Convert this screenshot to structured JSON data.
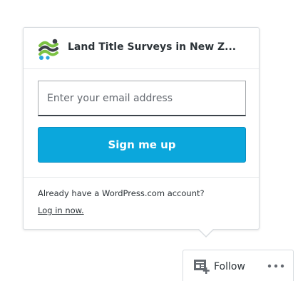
{
  "popup": {
    "site_title": "Land Title Surveys in New Z...",
    "site_icon": "site-logo-icon",
    "email_placeholder": "Enter your email address",
    "email_value": "",
    "signup_label": "Sign me up",
    "account_text": "Already have a WordPress.com account?",
    "login_label": "Log in now."
  },
  "action_bar": {
    "follow_label": "Follow",
    "follow_icon": "reader-follow-icon",
    "more_icon": "ellipsis-icon"
  },
  "colors": {
    "button": "#0ba7dc",
    "text": "#2c3338",
    "logo_green": "#7cc243",
    "logo_dark": "#3d4048",
    "logo_blue": "#2aa6dc",
    "icon_gray": "#646970"
  }
}
